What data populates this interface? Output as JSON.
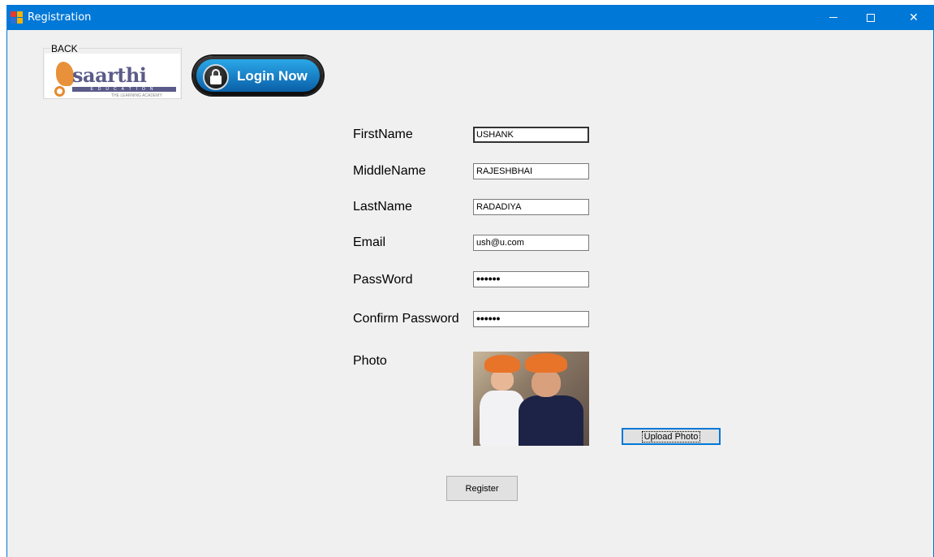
{
  "window": {
    "title": "Registration",
    "accent_color": "#0078d7",
    "icons": [
      "app-icon",
      "minimize-icon",
      "maximize-icon",
      "close-icon"
    ]
  },
  "header": {
    "back_group_label": "BACK",
    "logo_text": "saarthi",
    "logo_band": "EDUCATION",
    "logo_tagline": "THE LEARNING ACADEMY",
    "login_button_label": "Login Now",
    "login_icon": "lock-icon"
  },
  "form": {
    "first_name": {
      "label": "FirstName",
      "value": "USHANK"
    },
    "middle_name": {
      "label": "MiddleName",
      "value": "RAJESHBHAI"
    },
    "last_name": {
      "label": "LastName",
      "value": "RADADIYA"
    },
    "email": {
      "label": "Email",
      "value": "ush@u.com"
    },
    "password": {
      "label": "PassWord",
      "value": "••••••"
    },
    "confirm_password": {
      "label": "Confirm Password",
      "value": "••••••"
    },
    "photo": {
      "label": "Photo"
    },
    "upload_button_label": "Upload Photo",
    "register_button_label": "Register"
  }
}
